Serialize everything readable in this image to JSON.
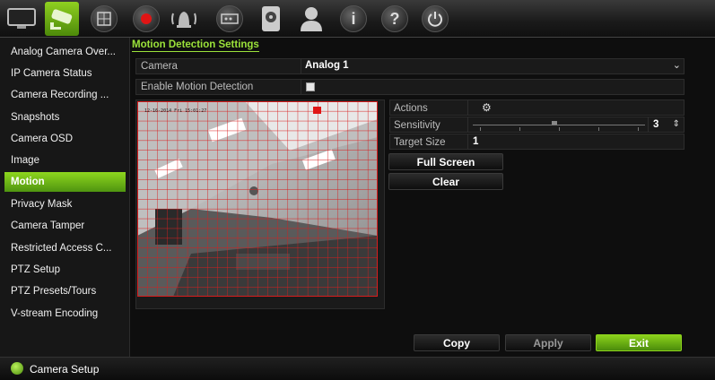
{
  "toolbar": {
    "items": [
      "display-icon",
      "camera-icon",
      "network-icon",
      "record-icon",
      "alarm-icon",
      "device-icon",
      "storage-icon",
      "user-icon",
      "info-icon",
      "help-icon",
      "power-icon"
    ]
  },
  "sidebar": {
    "items": [
      {
        "label": "Analog Camera Over..."
      },
      {
        "label": "IP Camera Status"
      },
      {
        "label": "Camera Recording ..."
      },
      {
        "label": "Snapshots"
      },
      {
        "label": "Camera OSD"
      },
      {
        "label": "Image"
      },
      {
        "label": "Motion"
      },
      {
        "label": "Privacy Mask"
      },
      {
        "label": "Camera Tamper"
      },
      {
        "label": "Restricted Access C..."
      },
      {
        "label": "PTZ Setup"
      },
      {
        "label": "PTZ Presets/Tours"
      },
      {
        "label": "V-stream Encoding"
      }
    ],
    "active_index": 6
  },
  "main": {
    "title": "Motion Detection Settings",
    "camera_label": "Camera",
    "camera_value": "Analog 1",
    "enable_label": "Enable Motion Detection",
    "enable_checked": false,
    "actions_label": "Actions",
    "sensitivity_label": "Sensitivity",
    "sensitivity_value": "3",
    "target_size_label": "Target Size",
    "target_size_value": "1",
    "full_screen_label": "Full Screen",
    "clear_label": "Clear",
    "preview_osd": "12-16-2014 Fri 15:01:27"
  },
  "footer": {
    "copy_label": "Copy",
    "apply_label": "Apply",
    "exit_label": "Exit"
  },
  "status": {
    "text": "Camera Setup"
  },
  "colors": {
    "accent": "#8cd21c",
    "title": "#9be23a",
    "grid": "#d81e1e"
  }
}
